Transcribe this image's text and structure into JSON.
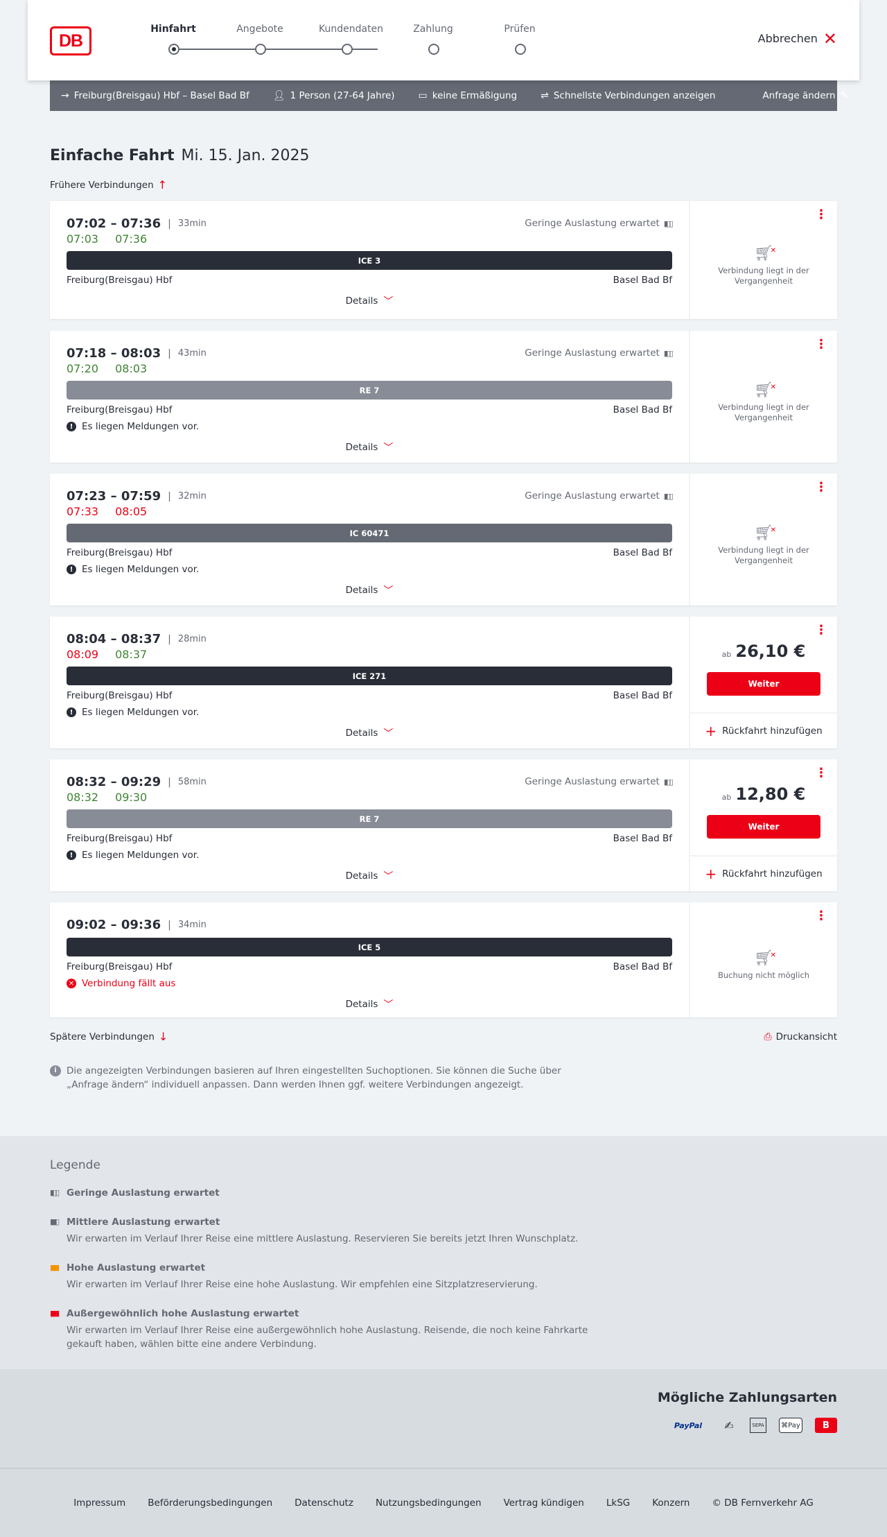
{
  "header": {
    "logo": "DB",
    "steps": [
      "Hinfahrt",
      "Angebote",
      "Kundendaten",
      "Zahlung",
      "Prüfen"
    ],
    "cancel": "Abbrechen"
  },
  "search": {
    "route": "Freiburg(Breisgau) Hbf – Basel Bad Bf",
    "persons": "1 Person (27-64 Jahre)",
    "discount": "keine Ermäßigung",
    "fastest": "Schnellste Verbindungen anzeigen",
    "change": "Anfrage ändern"
  },
  "page": {
    "title": "Einfache Fahrt",
    "date": "Mi. 15. Jan. 2025",
    "earlier": "Frühere Verbindungen",
    "later": "Spätere Verbindungen",
    "print": "Druckansicht",
    "info": "Die angezeigten Verbindungen basieren auf Ihren eingestellten Suchoptionen. Sie können die Suche über „Anfrage ändern“ individuell anpassen. Dann werden Ihnen ggf. weitere Verbindungen angezeigt.",
    "details": "Details",
    "load_low": "Geringe Auslastung erwartet",
    "msg_notice": "Es liegen Meldungen vor.",
    "msg_cancel": "Verbindung fällt aus",
    "past": "Verbindung liegt in der Vergangenheit",
    "no_booking": "Buchung nicht möglich",
    "price_prefix": "ab",
    "continue": "Weiter",
    "return": "Rückfahrt hinzufügen"
  },
  "connections": [
    {
      "time": "07:02 – 07:36",
      "dur": "33min",
      "rt_dep": "07:03",
      "rt_arr": "07:36",
      "train": "ICE 3",
      "from": "Freiburg(Breisgau) Hbf",
      "to": "Basel Bad Bf"
    },
    {
      "time": "07:18 – 08:03",
      "dur": "43min",
      "rt_dep": "07:20",
      "rt_arr": "08:03",
      "train": "RE 7",
      "from": "Freiburg(Breisgau) Hbf",
      "to": "Basel Bad Bf"
    },
    {
      "time": "07:23 – 07:59",
      "dur": "32min",
      "rt_dep": "07:33",
      "rt_arr": "08:05",
      "train": "IC 60471",
      "from": "Freiburg(Breisgau) Hbf",
      "to": "Basel Bad Bf"
    },
    {
      "time": "08:04 – 08:37",
      "dur": "28min",
      "rt_dep": "08:09",
      "rt_arr": "08:37",
      "train": "ICE 271",
      "from": "Freiburg(Breisgau) Hbf",
      "to": "Basel Bad Bf",
      "price": "26,10 €"
    },
    {
      "time": "08:32 – 09:29",
      "dur": "58min",
      "rt_dep": "08:32",
      "rt_arr": "09:30",
      "train": "RE 7",
      "from": "Freiburg(Breisgau) Hbf",
      "to": "Basel Bad Bf",
      "price": "12,80 €"
    },
    {
      "time": "09:02 – 09:36",
      "dur": "34min",
      "train": "ICE 5",
      "from": "Freiburg(Breisgau) Hbf",
      "to": "Basel Bad Bf"
    }
  ],
  "legend": {
    "title": "Legende",
    "items": [
      {
        "title": "Geringe Auslastung erwartet",
        "desc": ""
      },
      {
        "title": "Mittlere Auslastung erwartet",
        "desc": "Wir erwarten im Verlauf Ihrer Reise eine mittlere Auslastung. Reservieren Sie bereits jetzt Ihren Wunschplatz."
      },
      {
        "title": "Hohe Auslastung erwartet",
        "desc": "Wir erwarten im Verlauf Ihrer Reise eine hohe Auslastung. Wir empfehlen eine Sitzplatzreservierung."
      },
      {
        "title": "Außergewöhnlich hohe Auslastung erwartet",
        "desc": "Wir erwarten im Verlauf Ihrer Reise eine außergewöhnlich hohe Auslastung. Reisende, die noch keine Fahrkarte gekauft haben, wählen bitte eine andere Verbindung."
      }
    ]
  },
  "payments": {
    "title": "Mögliche Zahlungsarten",
    "methods": [
      "PayPal",
      "SEPA",
      "Pay"
    ]
  },
  "footer": [
    "Impressum",
    "Beförderungsbedingungen",
    "Datenschutz",
    "Nutzungsbedingungen",
    "Vertrag kündigen",
    "LkSG",
    "Konzern",
    "© DB Fernverkehr AG"
  ]
}
